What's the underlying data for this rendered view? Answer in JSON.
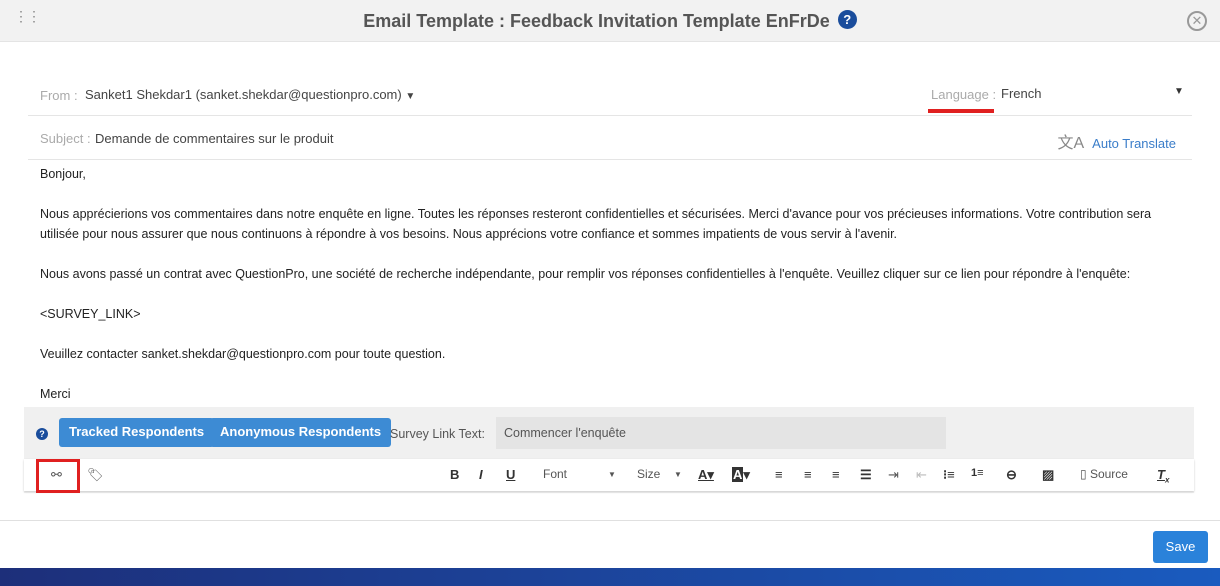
{
  "header": {
    "title": "Email Template : Feedback Invitation Template EnFrDe",
    "help_icon": "question-circle-icon",
    "close_icon": "close-circle-icon"
  },
  "from": {
    "label": "From :",
    "value": "Sanket1 Shekdar1 (sanket.shekdar@questionpro.com)"
  },
  "language": {
    "label": "Language :",
    "value": "French"
  },
  "subject": {
    "label": "Subject :",
    "value": "Demande de commentaires sur le produit"
  },
  "auto_translate": "Auto Translate",
  "body": [
    "Bonjour,",
    "Nous apprécierions vos commentaires dans notre enquête en ligne. Toutes les réponses resteront confidentielles et sécurisées. Merci d'avance pour vos précieuses informations. Votre contribution sera utilisée pour nous assurer que nous continuons à répondre à vos besoins. Nous apprécions votre confiance et sommes impatients de vous servir à l'avenir.",
    "Nous avons passé un contrat avec QuestionPro, une société de recherche indépendante, pour remplir vos réponses confidentielles à l'enquête. Veuillez cliquer sur ce lien pour répondre à l'enquête:",
    "<SURVEY_LINK>",
    "Veuillez contacter sanket.shekdar@questionpro.com pour toute question.",
    "Merci"
  ],
  "respondents": {
    "tracked": "Tracked Respondents",
    "anonymous": "Anonymous Respondents",
    "link_text_label": "Survey Link Text:",
    "link_text_value": "Commencer l'enquête"
  },
  "toolbar": {
    "bold": "B",
    "italic": "I",
    "underline": "U",
    "font": "Font",
    "size": "Size",
    "source": "Source"
  },
  "save": "Save",
  "colors": {
    "primary": "#3d8bd4",
    "highlight": "#e02020",
    "footer": "#1d2f7a"
  }
}
